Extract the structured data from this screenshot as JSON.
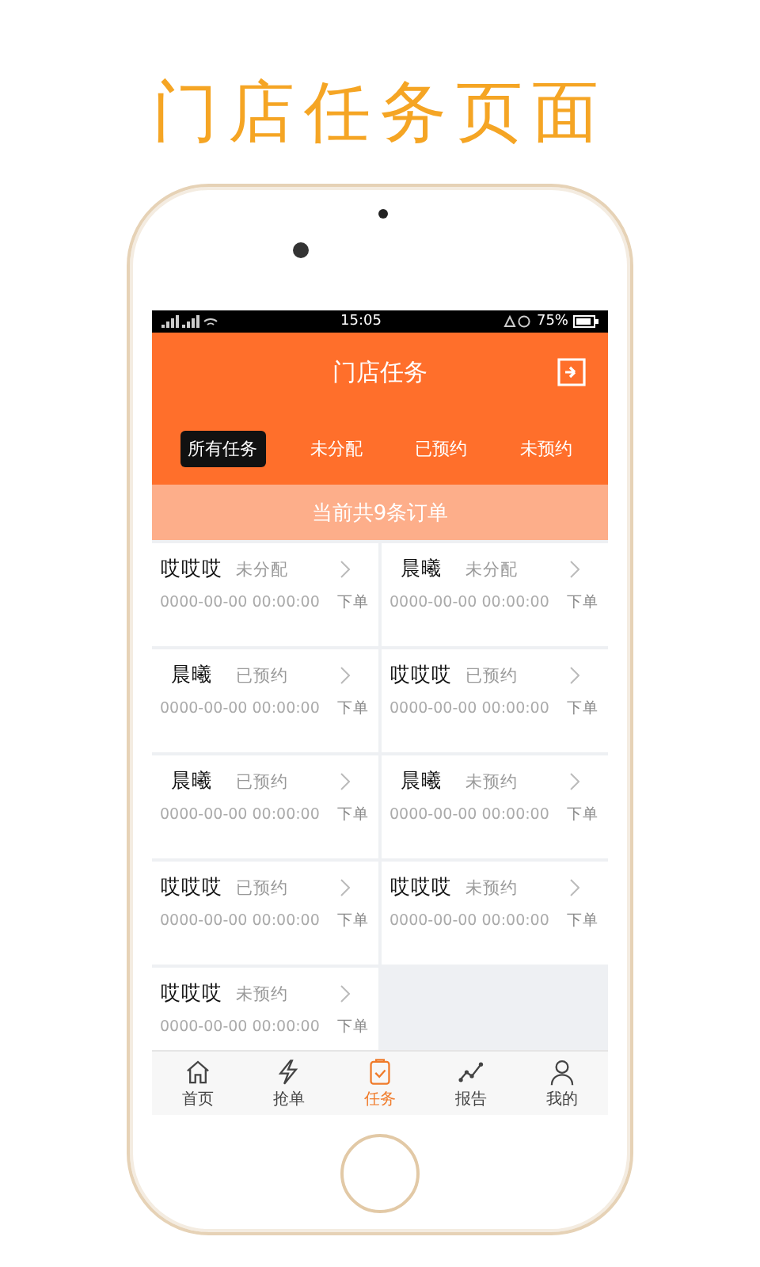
{
  "page_title": "门店任务页面",
  "status_bar": {
    "time": "15:05",
    "battery": "75%"
  },
  "header": {
    "title": "门店任务"
  },
  "tabs": [
    {
      "label": "所有任务",
      "selected": true
    },
    {
      "label": "未分配",
      "selected": false
    },
    {
      "label": "已预约",
      "selected": false
    },
    {
      "label": "未预约",
      "selected": false
    }
  ],
  "banner": "当前共9条订单",
  "orders": [
    {
      "name": "哎哎哎",
      "status": "未分配",
      "time": "0000-00-00 00:00:00",
      "action": "下单"
    },
    {
      "name": "晨曦",
      "status": "未分配",
      "time": "0000-00-00 00:00:00",
      "action": "下单"
    },
    {
      "name": "晨曦",
      "status": "已预约",
      "time": "0000-00-00 00:00:00",
      "action": "下单"
    },
    {
      "name": "哎哎哎",
      "status": "已预约",
      "time": "0000-00-00 00:00:00",
      "action": "下单"
    },
    {
      "name": "晨曦",
      "status": "已预约",
      "time": "0000-00-00 00:00:00",
      "action": "下单"
    },
    {
      "name": "晨曦",
      "status": "未预约",
      "time": "0000-00-00 00:00:00",
      "action": "下单"
    },
    {
      "name": "哎哎哎",
      "status": "已预约",
      "time": "0000-00-00 00:00:00",
      "action": "下单"
    },
    {
      "name": "哎哎哎",
      "status": "未预约",
      "time": "0000-00-00 00:00:00",
      "action": "下单"
    },
    {
      "name": "哎哎哎",
      "status": "未预约",
      "time": "0000-00-00 00:00:00",
      "action": "下单"
    }
  ],
  "nav": [
    {
      "label": "首页",
      "kind": "home",
      "selected": false
    },
    {
      "label": "抢单",
      "kind": "bolt",
      "selected": false
    },
    {
      "label": "任务",
      "kind": "clipboard",
      "selected": true
    },
    {
      "label": "报告",
      "kind": "chart",
      "selected": false
    },
    {
      "label": "我的",
      "kind": "person",
      "selected": false
    }
  ]
}
